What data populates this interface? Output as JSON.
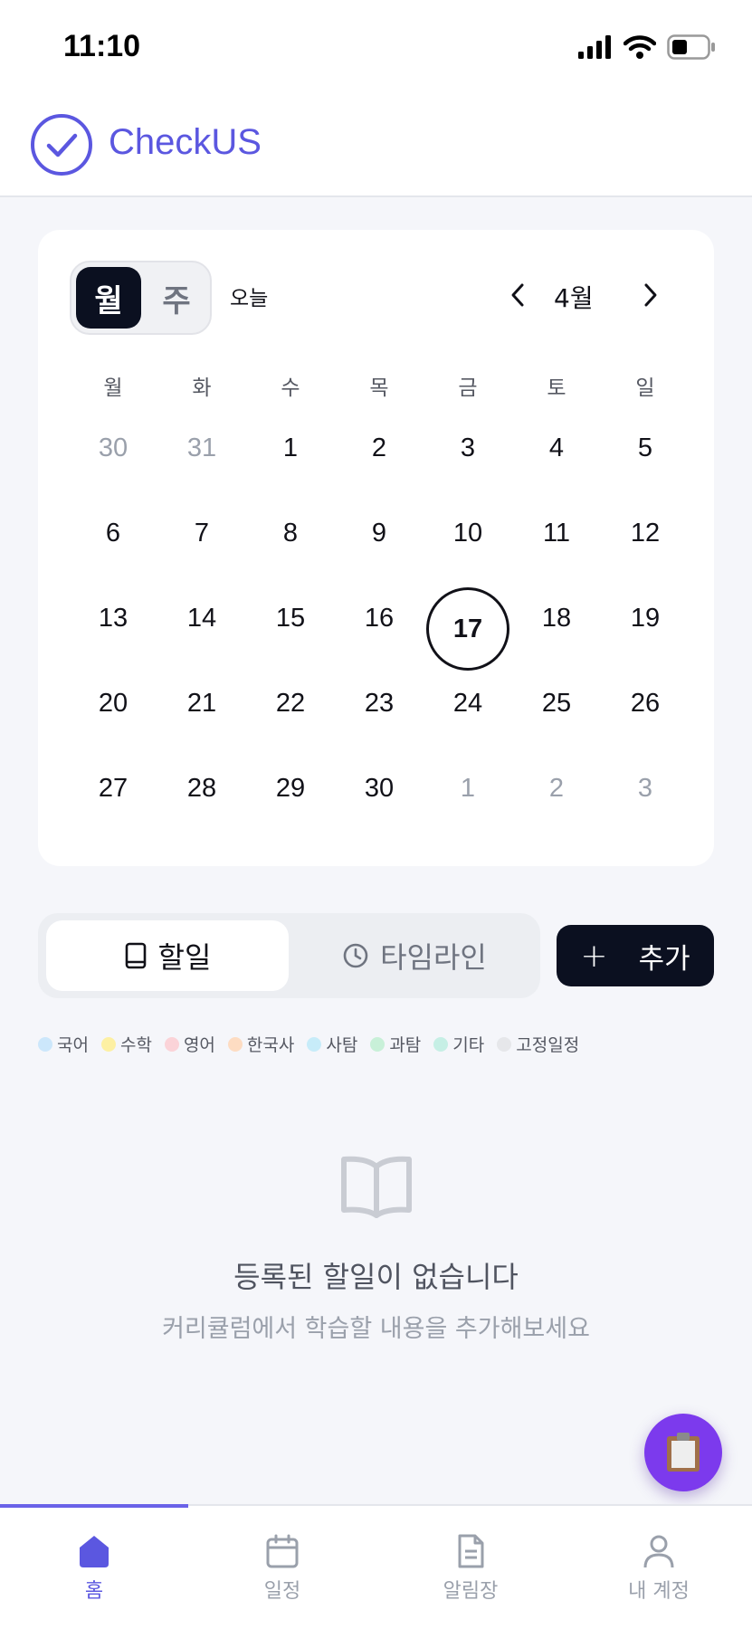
{
  "status_bar": {
    "time": "11:10"
  },
  "header": {
    "app_name": "CheckUS"
  },
  "calendar": {
    "view_toggle": {
      "month": "월",
      "week": "주"
    },
    "today_button": "오늘",
    "month_label": "4월",
    "weekdays": [
      "월",
      "화",
      "수",
      "목",
      "금",
      "토",
      "일"
    ],
    "weeks": [
      [
        "30",
        "31",
        "1",
        "2",
        "3",
        "4",
        "5"
      ],
      [
        "6",
        "7",
        "8",
        "9",
        "10",
        "11",
        "12"
      ],
      [
        "13",
        "14",
        "15",
        "16",
        "17",
        "18",
        "19"
      ],
      [
        "20",
        "21",
        "22",
        "23",
        "24",
        "25",
        "26"
      ],
      [
        "27",
        "28",
        "29",
        "30",
        "1",
        "2",
        "3"
      ]
    ],
    "muted_cells": [
      "0-0",
      "0-1",
      "4-4",
      "4-5",
      "4-6"
    ],
    "today_cell": "2-4"
  },
  "tasks": {
    "tabs": {
      "todo": "할일",
      "timeline": "타임라인"
    },
    "add_button": "추가"
  },
  "legend": [
    {
      "label": "국어",
      "color": "#cce7fb"
    },
    {
      "label": "수학",
      "color": "#fdf0a3"
    },
    {
      "label": "영어",
      "color": "#fbd3d8"
    },
    {
      "label": "한국사",
      "color": "#fddcc2"
    },
    {
      "label": "사탐",
      "color": "#c7ecf9"
    },
    {
      "label": "과탐",
      "color": "#c8f0d8"
    },
    {
      "label": "기타",
      "color": "#c6efe5"
    },
    {
      "label": "고정일정",
      "color": "#e6e7ea"
    }
  ],
  "empty_state": {
    "title": "등록된 할일이 없습니다",
    "subtitle": "커리큘럼에서 학습할 내용을 추가해보세요"
  },
  "bottom_nav": {
    "home": "홈",
    "schedule": "일정",
    "notice": "알림장",
    "account": "내 계정"
  },
  "colors": {
    "brand": "#5b57e0",
    "dark": "#0b1020",
    "fab": "#7c3aed"
  }
}
